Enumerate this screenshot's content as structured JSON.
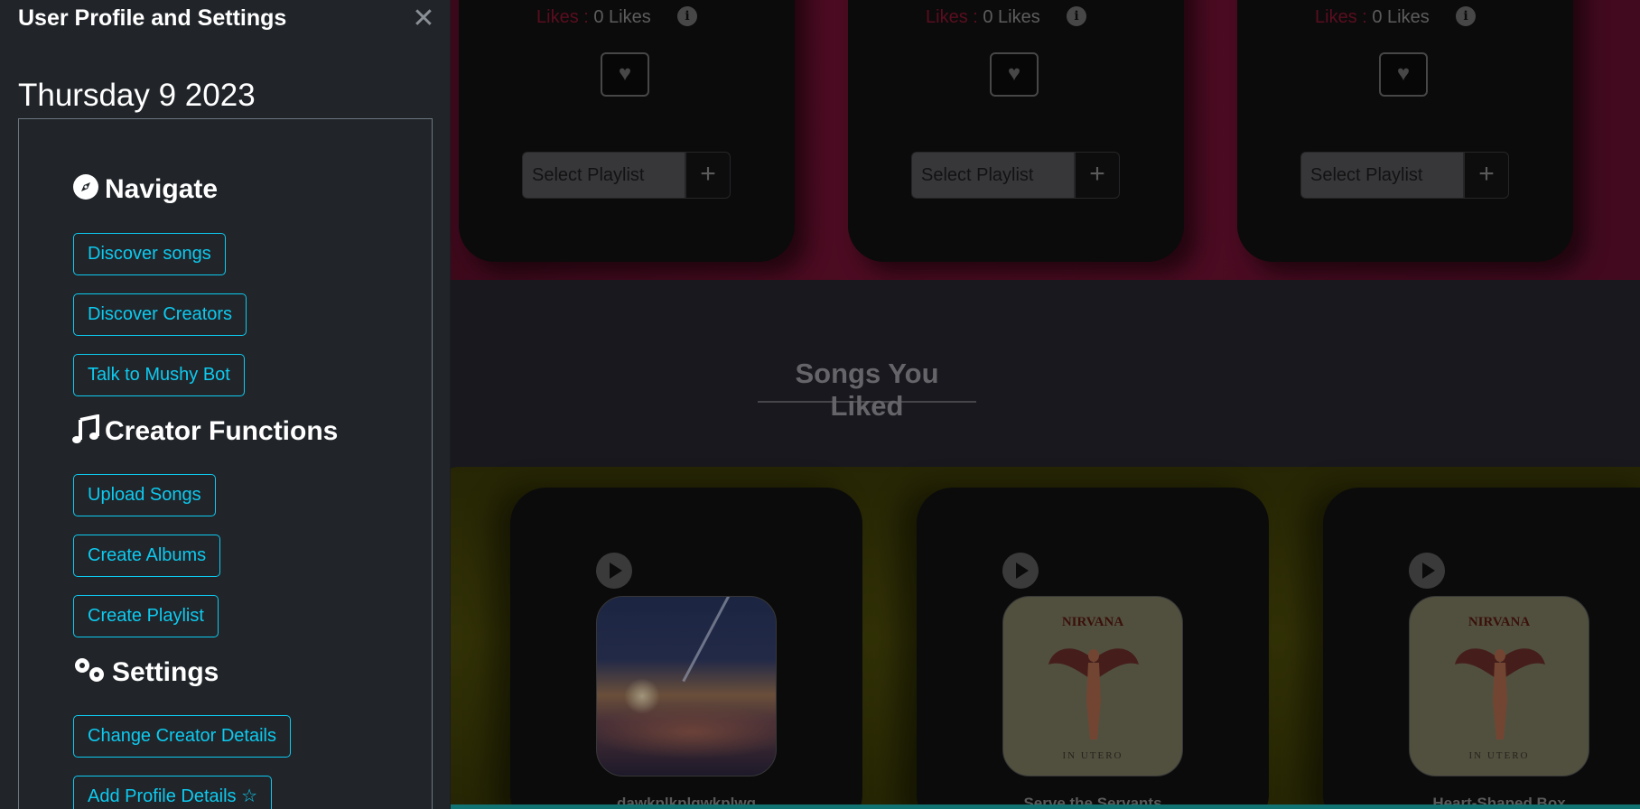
{
  "top_cards": [
    {
      "likes_label": "Likes :",
      "likes_value": "0 Likes",
      "select_label": "Select Playlist",
      "add_label": "+"
    },
    {
      "likes_label": "Likes :",
      "likes_value": "0 Likes",
      "select_label": "Select Playlist",
      "add_label": "+"
    },
    {
      "likes_label": "Likes :",
      "likes_value": "0 Likes",
      "select_label": "Select Playlist",
      "add_label": "+"
    }
  ],
  "liked_section": {
    "title": "Songs You Liked"
  },
  "liked_songs": [
    {
      "title": "dawkplkplqwkplwq",
      "cover": "sky-clouds"
    },
    {
      "title": "Serve the Servants",
      "cover": "nirvana-in-utero",
      "cover_band": "NIRVANA",
      "cover_album": "IN UTERO"
    },
    {
      "title": "Heart-Shaped Box",
      "cover": "nirvana-in-utero",
      "cover_band": "NIRVANA",
      "cover_album": "IN UTERO"
    }
  ],
  "offcanvas": {
    "title": "User Profile and Settings",
    "close_icon": "close-icon",
    "date": "Thursday 9 2023",
    "navigate": {
      "heading": "Navigate",
      "icon": "compass-icon",
      "buttons": [
        "Discover songs",
        "Discover Creators",
        "Talk to Mushy Bot"
      ]
    },
    "creator": {
      "heading": "Creator Functions",
      "icon": "music-note-icon",
      "buttons": [
        "Upload Songs",
        "Create Albums",
        "Create Playlist"
      ]
    },
    "settings": {
      "heading": "Settings",
      "icon": "gears-icon",
      "buttons": [
        "Change Creator Details",
        "Add Profile Details"
      ],
      "star_icon": "star-icon"
    }
  },
  "colors": {
    "accent": "#0dcaf0",
    "panel_bg": "#212529",
    "likes_label": "#dc3545",
    "top_band": "#7a1236",
    "bottom_band": "#4d4c0a"
  }
}
